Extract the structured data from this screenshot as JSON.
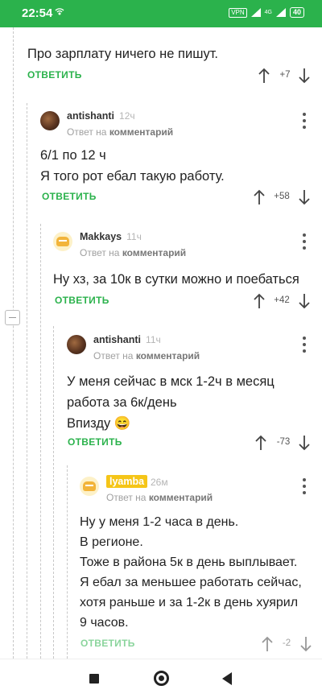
{
  "status_bar": {
    "time": "22:54",
    "vpn": "VPN",
    "network": "4G",
    "battery": "40"
  },
  "colors": {
    "accent": "#2bb24c",
    "highlight_user": "#f5c518"
  },
  "reply_label": "ОТВЕТИТЬ",
  "top_comment": {
    "text": "Про зарплату ничего не пишут.",
    "score": "+7"
  },
  "comments": [
    {
      "user": "antishanti",
      "time": "12ч",
      "reply_prefix": "Ответ на",
      "reply_target": "комментарий",
      "lines": [
        "6/1 по 12 ч",
        "Я того рот ебал такую работу."
      ],
      "score": "+58"
    },
    {
      "user": "Makkays",
      "time": "11ч",
      "reply_prefix": "Ответ на",
      "reply_target": "комментарий",
      "lines": [
        "Ну хз, за 10к в сутки можно и поебаться"
      ],
      "score": "+42"
    },
    {
      "user": "antishanti",
      "time": "11ч",
      "reply_prefix": "Ответ на",
      "reply_target": "комментарий",
      "lines": [
        "У меня сейчас в мск 1-2ч в месяц",
        "работа за 6к/день",
        "Впизду 😄"
      ],
      "score": "-73"
    },
    {
      "user": "lyamba",
      "time": "26м",
      "reply_prefix": "Ответ на",
      "reply_target": "комментарий",
      "lines": [
        "Ну у меня 1-2 часа в день.",
        "В регионе.",
        "Тоже в района 5к в день выплывает.",
        "Я ебал за меньшее работать сейчас,",
        "хотя раньше и за 1-2к в день хуярил",
        "9 часов."
      ],
      "score": "-2"
    }
  ]
}
